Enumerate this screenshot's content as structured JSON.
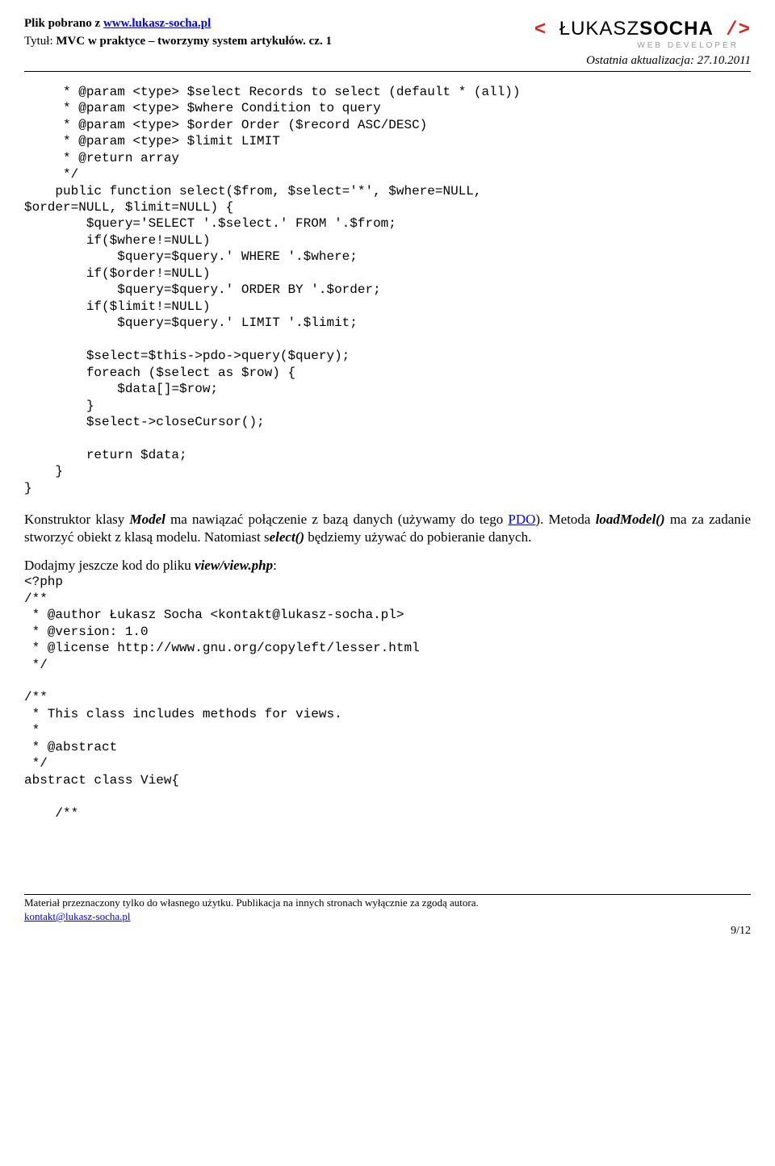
{
  "header": {
    "download_label": "Plik pobrano z ",
    "download_url": "www.lukasz-socha.pl",
    "title_label": "Tytuł: ",
    "title": "MVC w praktyce – tworzymy system artykułów. cz. 1",
    "logo_first": "ŁUKASZ",
    "logo_bold": "SOCHA",
    "logo_slash": " /",
    "subtitle": "WEB DEVELOPER",
    "updated": "Ostatnia aktualizacja: 27.10.2011"
  },
  "code_block_1": "     * @param <type> $select Records to select (default * (all))\n     * @param <type> $where Condition to query\n     * @param <type> $order Order ($record ASC/DESC)\n     * @param <type> $limit LIMIT\n     * @return array\n     */\n    public function select($from, $select='*', $where=NULL,\n$order=NULL, $limit=NULL) {\n        $query='SELECT '.$select.' FROM '.$from;\n        if($where!=NULL)\n            $query=$query.' WHERE '.$where;\n        if($order!=NULL)\n            $query=$query.' ORDER BY '.$order;\n        if($limit!=NULL)\n            $query=$query.' LIMIT '.$limit;\n\n        $select=$this->pdo->query($query);\n        foreach ($select as $row) {\n            $data[]=$row;\n        }\n        $select->closeCursor();\n\n        return $data;\n    }\n}",
  "paragraph1": {
    "p1a": "Konstruktor klasy ",
    "p1_model": "Model",
    "p1b": " ma nawiązać połączenie z bazą danych (używamy do tego ",
    "p1_pdo": "PDO",
    "p1c": "). Metoda ",
    "p1_loadmodel": "loadModel()",
    "p1d": " ma za zadanie stworzyć obiekt z klasą modelu. Natomiast s",
    "p1_select": "elect()",
    "p1e": " będziemy używać do pobieranie danych."
  },
  "paragraph2": {
    "p2a": "Dodajmy jeszcze kod do pliku ",
    "p2_file": "view/view.php",
    "p2b": ":"
  },
  "code_block_2": "<?php\n/**\n * @author Łukasz Socha <kontakt@lukasz-socha.pl>\n * @version: 1.0\n * @license http://www.gnu.org/copyleft/lesser.html\n */\n\n/**\n * This class includes methods for views.\n *\n * @abstract\n */\nabstract class View{\n\n    /**",
  "footer": {
    "text": "Materiał przeznaczony tylko do własnego użytku. Publikacja na innych stronach wyłącznie za zgodą autora.",
    "email": "kontakt@lukasz-socha.pl",
    "page": "9/12"
  }
}
